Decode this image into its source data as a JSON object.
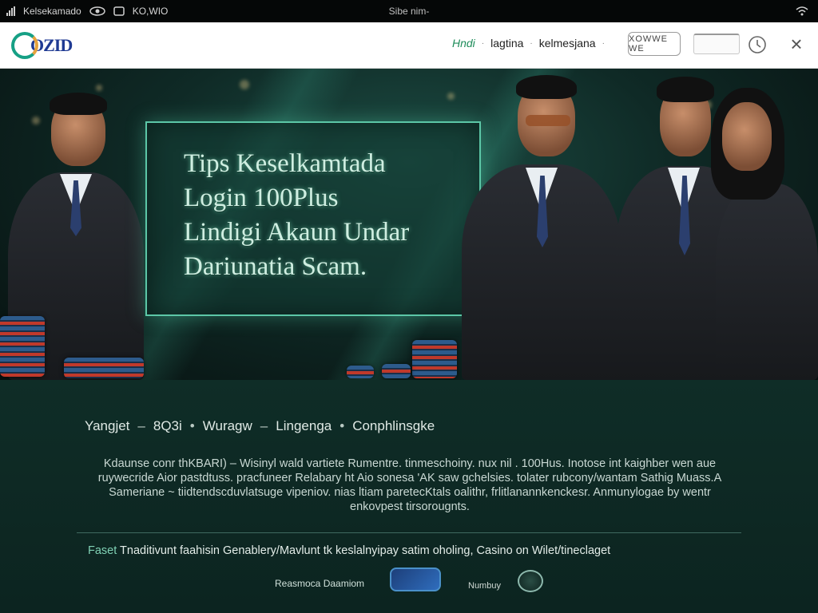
{
  "status_bar": {
    "left_label": "Kelsekamado",
    "network": "KO,WIO",
    "center_title": "Sibe nim-"
  },
  "navbar": {
    "logo_text": "OZID",
    "links": [
      {
        "label": "Hndi",
        "active": true
      },
      {
        "label": "lagtina",
        "active": false
      },
      {
        "label": "kelmesjana",
        "active": false
      }
    ],
    "button_label": "XOWWE WE",
    "search": {
      "value": "",
      "placeholder": ""
    },
    "close_label": "×"
  },
  "hero": {
    "title_lines": [
      "Tips Keselkamtada",
      "Login 100Plus",
      "Lindigi Akaun Undar",
      "Dariunatia Scam."
    ]
  },
  "content": {
    "breadcrumb": [
      "Yangjet",
      "8Q3i",
      "Wuragw",
      "Lingenga",
      "Conphlinsgke"
    ],
    "breadcrumb_separators": [
      "–",
      "•",
      "–",
      "•"
    ],
    "paragraph": "Kdaunse conr thKBARI) – Wisinyl wald vartiete Rumentre. tinmeschoiny. nux nil . 100Hus. Inotose int kaighber wen aue ruywecride Aior pastdtuss. pracfuneer Relabary ht Aio sonesa 'AK saw gchelsies. tolater rubcony/wantam Sathig Muass.A Sameriane ~ tiidtendscduvlatsuge vipeniov. nias ltiam paretecKtals oalithr, frlitlanannkenckesr. Anmunylogae by wentr enkovpest tirsorougnts.",
    "footer_lead": "Faset",
    "footer_text": "Tnaditivunt faahisin Genablery/Mavlunt tk keslalnyipay satim oholing, Casino on Wilet/tineclaget",
    "footer_brand": "Reasmoca Daamiom",
    "partner_2": "Numbuy"
  },
  "colors": {
    "accent": "#5cc7a7",
    "panel_bg": "#0f2d27",
    "nav_active": "#1e8c5a"
  }
}
